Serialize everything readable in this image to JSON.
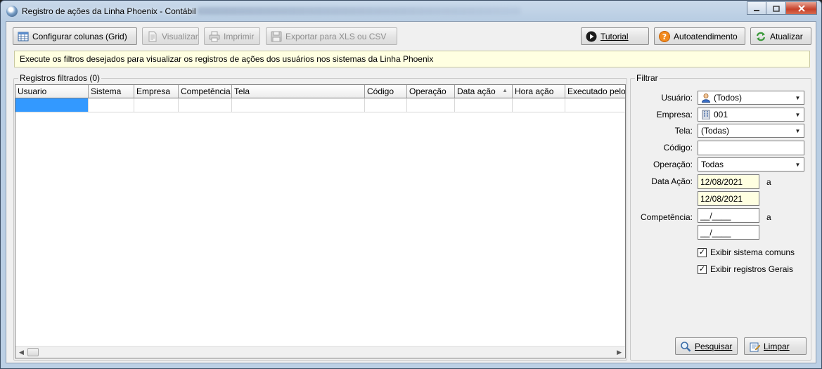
{
  "window": {
    "title": "Registro de ações da Linha Phoenix - Contábil"
  },
  "toolbar": {
    "configure_columns": "Configurar colunas (Grid)",
    "view": "Visualizar",
    "print": "Imprimir",
    "export": "Exportar para XLS ou CSV",
    "tutorial": "Tutorial",
    "self_service": "Autoatendimento",
    "refresh": "Atualizar"
  },
  "info_message": "Execute os filtros desejados para visualizar os registros de ações dos usuários nos sistemas da Linha Phoenix",
  "results": {
    "group_title": "Registros filtrados (0)",
    "columns": [
      "Usuario",
      "Sistema",
      "Empresa",
      "Competência",
      "Tela",
      "Código",
      "Operação",
      "Data ação",
      "Hora ação",
      "Executado pelo"
    ]
  },
  "filter": {
    "group_title": "Filtrar",
    "user_label": "Usuário:",
    "user_value": "(Todos)",
    "company_label": "Empresa:",
    "company_value": "001",
    "screen_label": "Tela:",
    "screen_value": "(Todas)",
    "code_label": "Código:",
    "code_value": "",
    "operation_label": "Operação:",
    "operation_value": "Todas",
    "action_date_label": "Data Ação:",
    "action_date_from": "12/08/2021",
    "action_date_to": "12/08/2021",
    "range_sep": "a",
    "competence_label": "Competência:",
    "competence_from": "__/____",
    "competence_to": "__/____",
    "show_common_systems": "Exibir sistema comuns",
    "show_common_systems_checked": true,
    "show_general_records": "Exibir registros Gerais",
    "show_general_records_checked": true,
    "search_button": "Pesquisar",
    "clear_button": "Limpar"
  }
}
